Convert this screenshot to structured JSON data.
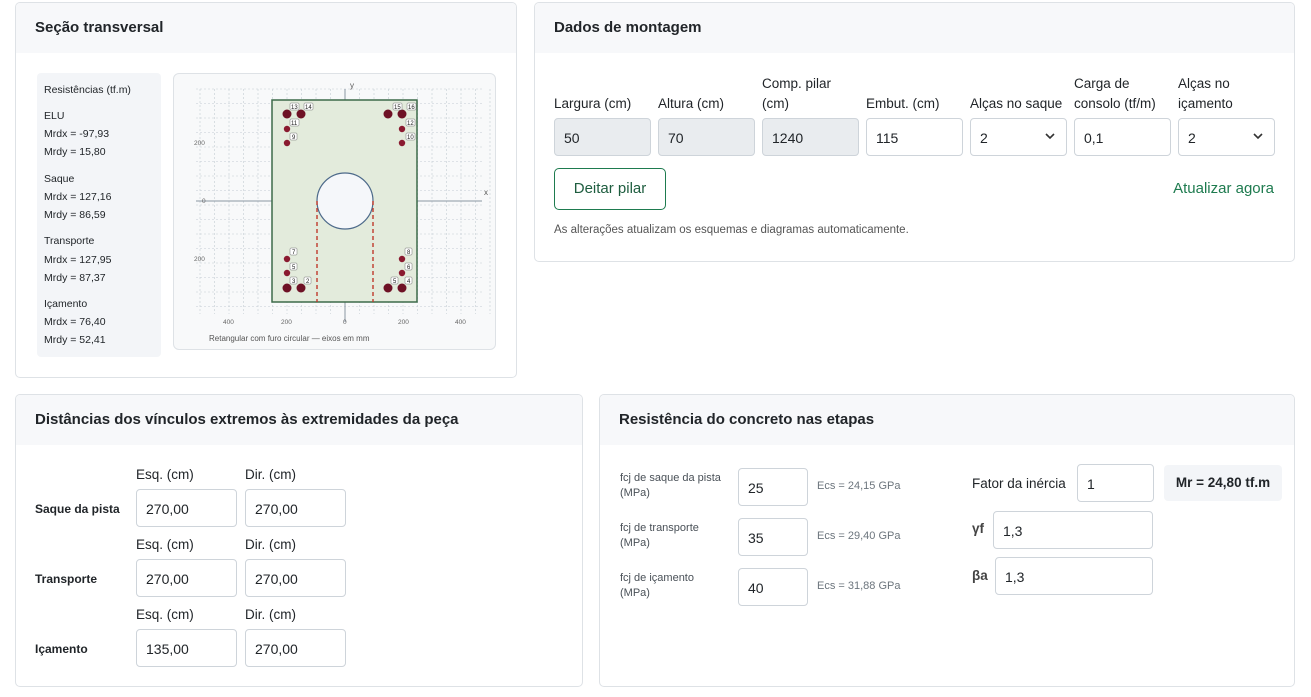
{
  "secao": {
    "title": "Seção transversal",
    "resistencias": {
      "heading": "Resistências (tf.m)",
      "groups": [
        {
          "name": "ELU",
          "mrdx": "Mrdx = -97,93",
          "mrdy": "Mrdy = 15,80"
        },
        {
          "name": "Saque",
          "mrdx": "Mrdx = 127,16",
          "mrdy": "Mrdy = 86,59"
        },
        {
          "name": "Transporte",
          "mrdx": "Mrdx = 127,95",
          "mrdy": "Mrdy = 87,37"
        },
        {
          "name": "Içamento",
          "mrdx": "Mrdx = 76,40",
          "mrdy": "Mrdy = 52,41"
        }
      ]
    },
    "plot": {
      "axis_x": "x",
      "axis_y": "y",
      "x_ticks": [
        "400",
        "200",
        "0",
        "200",
        "400"
      ],
      "y_ticks": [
        "200",
        "0",
        "200"
      ],
      "caption": "Retangular com furo circular — eixos em mm",
      "colors": {
        "section_fill": "#e3ebdc",
        "section_stroke": "#3d6b4a",
        "bar": "#6e1125",
        "bar_small": "#8a1a30",
        "dashed": "#c0392b",
        "grid": "#b9c2cc"
      },
      "bars_top_left": [
        "13",
        "14",
        "11",
        "9"
      ],
      "bars_top_right": [
        "15",
        "16",
        "12",
        "10"
      ],
      "bars_bottom_left": [
        "7",
        "5",
        "3",
        "1",
        "2"
      ],
      "bars_bottom_right": [
        "8",
        "6",
        "5",
        "3",
        "4"
      ]
    }
  },
  "montagem": {
    "title": "Dados de montagem",
    "fields": {
      "largura_label": "Largura (cm)",
      "largura_value": "50",
      "altura_label": "Altura (cm)",
      "altura_value": "70",
      "comp_label_1": "Comp. pilar",
      "comp_label_2": "(cm)",
      "comp_value": "1240",
      "embut_label": "Embut. (cm)",
      "embut_value": "115",
      "alcas_saque_label": "Alças no saque",
      "alcas_saque_value": "2",
      "carga_label_1": "Carga de",
      "carga_label_2": "consolo (tf/m)",
      "carga_value": "0,1",
      "alcas_icam_label_1": "Alças no",
      "alcas_icam_label_2": "içamento",
      "alcas_icam_value": "2"
    },
    "deitar_button": "Deitar pilar",
    "atualizar_link": "Atualizar agora",
    "note": "As alterações atualizam os esquemas e diagramas automaticamente."
  },
  "distancias": {
    "title": "Distâncias dos vínculos extremos às extremidades da peça",
    "rows": [
      {
        "label": "Saque da pista",
        "esq_label": "Esq. (cm)",
        "dir_label": "Dir. (cm)",
        "esq": "270,00",
        "dir": "270,00"
      },
      {
        "label": "Transporte",
        "esq_label": "Esq. (cm)",
        "dir_label": "Dir. (cm)",
        "esq": "270,00",
        "dir": "270,00"
      },
      {
        "label": "Içamento",
        "esq_label": "Esq. (cm)",
        "dir_label": "Dir. (cm)",
        "esq": "135,00",
        "dir": "270,00"
      }
    ]
  },
  "concreto": {
    "title": "Resistência do concreto nas etapas",
    "rows": [
      {
        "label1": "fcj de saque da pista",
        "label2": "(MPa)",
        "value": "25",
        "ecs": "Ecs = 24,15 GPa"
      },
      {
        "label1": "fcj de transporte",
        "label2": "(MPa)",
        "value": "35",
        "ecs": "Ecs = 29,40 GPa"
      },
      {
        "label1": "fcj de içamento",
        "label2": "(MPa)",
        "value": "40",
        "ecs": "Ecs = 31,88 GPa"
      }
    ],
    "fator_label": "Fator da inércia",
    "fator_value": "1",
    "mr_text": "Mr = 24,80 tf.m",
    "gf_label": "γf",
    "gf_value": "1,3",
    "ba_label": "βa",
    "ba_value": "1,3"
  },
  "accent_color": "#1e7b4f"
}
